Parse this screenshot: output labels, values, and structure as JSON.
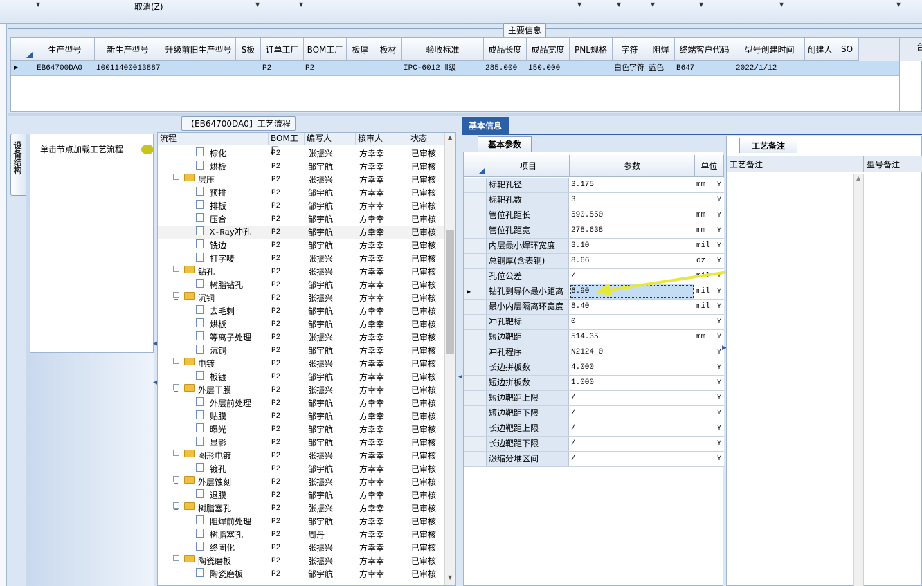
{
  "toolbar": {
    "cancel_label": "取消(Z)"
  },
  "main_info": {
    "title": "主要信息",
    "columns": [
      "生产型号",
      "新生产型号",
      "升级前旧生产型号",
      "S板",
      "订单工厂",
      "BOM工厂",
      "板厚",
      "板材",
      "验收标准",
      "成品长度",
      "成品宽度",
      "PNL规格",
      "字符",
      "阻焊",
      "终端客户代码",
      "型号创建时间",
      "创建人",
      "SO"
    ],
    "row": [
      "EB64700DA0",
      "10011400013887",
      "",
      "",
      "P2",
      "P2",
      "",
      "",
      "IPC-6012 Ⅱ级",
      "285.000",
      "150.000",
      "",
      "白色字符",
      "蓝色",
      "B647",
      "2022/1/12",
      "",
      ""
    ],
    "right_edge_text": "台"
  },
  "side_tab": {
    "label": "设备结构"
  },
  "tree_hint": {
    "label": "单击节点加载工艺流程"
  },
  "flow": {
    "title": "【EB64700DA0】工艺流程",
    "columns": [
      "流程",
      "BOM工厂",
      "编写人",
      "核审人",
      "状态"
    ],
    "rows": [
      {
        "name": "棕化",
        "level": 2,
        "bom": "P2",
        "author": "张振兴",
        "reviewer": "方幸幸",
        "status": "已审核"
      },
      {
        "name": "烘板",
        "level": 2,
        "bom": "P2",
        "author": "邹宇航",
        "reviewer": "方幸幸",
        "status": "已审核"
      },
      {
        "name": "层压",
        "level": 1,
        "bom": "P2",
        "author": "张振兴",
        "reviewer": "方幸幸",
        "status": "已审核"
      },
      {
        "name": "预排",
        "level": 2,
        "bom": "P2",
        "author": "邹宇航",
        "reviewer": "方幸幸",
        "status": "已审核"
      },
      {
        "name": "排板",
        "level": 2,
        "bom": "P2",
        "author": "邹宇航",
        "reviewer": "方幸幸",
        "status": "已审核"
      },
      {
        "name": "压合",
        "level": 2,
        "bom": "P2",
        "author": "邹宇航",
        "reviewer": "方幸幸",
        "status": "已审核"
      },
      {
        "name": "X-Ray冲孔",
        "level": 2,
        "bom": "P2",
        "author": "邹宇航",
        "reviewer": "方幸幸",
        "status": "已审核"
      },
      {
        "name": "铣边",
        "level": 2,
        "bom": "P2",
        "author": "邹宇航",
        "reviewer": "方幸幸",
        "status": "已审核"
      },
      {
        "name": "打字唛",
        "level": 2,
        "bom": "P2",
        "author": "张振兴",
        "reviewer": "方幸幸",
        "status": "已审核"
      },
      {
        "name": "钻孔",
        "level": 1,
        "bom": "P2",
        "author": "张振兴",
        "reviewer": "方幸幸",
        "status": "已审核"
      },
      {
        "name": "树脂钻孔",
        "level": 2,
        "bom": "P2",
        "author": "邹宇航",
        "reviewer": "方幸幸",
        "status": "已审核"
      },
      {
        "name": "沉铜",
        "level": 1,
        "bom": "P2",
        "author": "张振兴",
        "reviewer": "方幸幸",
        "status": "已审核"
      },
      {
        "name": "去毛刺",
        "level": 2,
        "bom": "P2",
        "author": "邹宇航",
        "reviewer": "方幸幸",
        "status": "已审核"
      },
      {
        "name": "烘板",
        "level": 2,
        "bom": "P2",
        "author": "邹宇航",
        "reviewer": "方幸幸",
        "status": "已审核"
      },
      {
        "name": "等离子处理",
        "level": 2,
        "bom": "P2",
        "author": "张振兴",
        "reviewer": "方幸幸",
        "status": "已审核"
      },
      {
        "name": "沉铜",
        "level": 2,
        "bom": "P2",
        "author": "邹宇航",
        "reviewer": "方幸幸",
        "status": "已审核"
      },
      {
        "name": "电镀",
        "level": 1,
        "bom": "P2",
        "author": "张振兴",
        "reviewer": "方幸幸",
        "status": "已审核"
      },
      {
        "name": "板镀",
        "level": 2,
        "bom": "P2",
        "author": "邹宇航",
        "reviewer": "方幸幸",
        "status": "已审核"
      },
      {
        "name": "外层干膜",
        "level": 1,
        "bom": "P2",
        "author": "张振兴",
        "reviewer": "方幸幸",
        "status": "已审核"
      },
      {
        "name": "外层前处理",
        "level": 2,
        "bom": "P2",
        "author": "邹宇航",
        "reviewer": "方幸幸",
        "status": "已审核"
      },
      {
        "name": "贴膜",
        "level": 2,
        "bom": "P2",
        "author": "邹宇航",
        "reviewer": "方幸幸",
        "status": "已审核"
      },
      {
        "name": "曝光",
        "level": 2,
        "bom": "P2",
        "author": "邹宇航",
        "reviewer": "方幸幸",
        "status": "已审核"
      },
      {
        "name": "显影",
        "level": 2,
        "bom": "P2",
        "author": "邹宇航",
        "reviewer": "方幸幸",
        "status": "已审核"
      },
      {
        "name": "图形电镀",
        "level": 1,
        "bom": "P2",
        "author": "张振兴",
        "reviewer": "方幸幸",
        "status": "已审核"
      },
      {
        "name": "镀孔",
        "level": 2,
        "bom": "P2",
        "author": "邹宇航",
        "reviewer": "方幸幸",
        "status": "已审核"
      },
      {
        "name": "外层蚀刻",
        "level": 1,
        "bom": "P2",
        "author": "张振兴",
        "reviewer": "方幸幸",
        "status": "已审核"
      },
      {
        "name": "退膜",
        "level": 2,
        "bom": "P2",
        "author": "邹宇航",
        "reviewer": "方幸幸",
        "status": "已审核"
      },
      {
        "name": "树脂塞孔",
        "level": 1,
        "bom": "P2",
        "author": "张振兴",
        "reviewer": "方幸幸",
        "status": "已审核"
      },
      {
        "name": "阻焊前处理",
        "level": 2,
        "bom": "P2",
        "author": "邹宇航",
        "reviewer": "方幸幸",
        "status": "已审核"
      },
      {
        "name": "树脂塞孔",
        "level": 2,
        "bom": "P2",
        "author": "周丹",
        "reviewer": "方幸幸",
        "status": "已审核"
      },
      {
        "name": "终固化",
        "level": 2,
        "bom": "P2",
        "author": "张振兴",
        "reviewer": "方幸幸",
        "status": "已审核"
      },
      {
        "name": "陶瓷磨板",
        "level": 1,
        "bom": "P2",
        "author": "张振兴",
        "reviewer": "方幸幸",
        "status": "已审核"
      },
      {
        "name": "陶瓷磨板",
        "level": 2,
        "bom": "P2",
        "author": "邹宇航",
        "reviewer": "方幸幸",
        "status": "已审核"
      }
    ]
  },
  "basic_info": {
    "tab_label": "基本信息",
    "subtab_label": "基本参数",
    "columns": [
      "项目",
      "参数",
      "单位"
    ],
    "rows": [
      {
        "item": "标靶孔径",
        "value": "3.175",
        "unit": "mm",
        "flag": "Y"
      },
      {
        "item": "标靶孔数",
        "value": "3",
        "unit": "",
        "flag": "Y"
      },
      {
        "item": "管位孔距长",
        "value": "590.550",
        "unit": "mm",
        "flag": "Y"
      },
      {
        "item": "管位孔距宽",
        "value": "278.638",
        "unit": "mm",
        "flag": "Y"
      },
      {
        "item": "内层最小焊环宽度",
        "value": "3.10",
        "unit": "mil",
        "flag": "Y"
      },
      {
        "item": "总铜厚(含表铜)",
        "value": "8.66",
        "unit": "oz",
        "flag": "Y"
      },
      {
        "item": "孔位公差",
        "value": "/",
        "unit": "mil",
        "flag": "Y"
      },
      {
        "item": "钻孔到导体最小距离",
        "value": "6.90",
        "unit": "mil",
        "flag": "Y"
      },
      {
        "item": "最小内层隔离环宽度",
        "value": "8.40",
        "unit": "mil",
        "flag": "Y"
      },
      {
        "item": "冲孔靶标",
        "value": "0",
        "unit": "",
        "flag": "Y"
      },
      {
        "item": "短边靶距",
        "value": "514.35",
        "unit": "mm",
        "flag": "Y"
      },
      {
        "item": "冲孔程序",
        "value": "N2124_0",
        "unit": "",
        "flag": "Y"
      },
      {
        "item": "长边拼板数",
        "value": "4.000",
        "unit": "",
        "flag": "Y"
      },
      {
        "item": "短边拼板数",
        "value": "1.000",
        "unit": "",
        "flag": "Y"
      },
      {
        "item": "短边靶距上限",
        "value": "/",
        "unit": "",
        "flag": "Y"
      },
      {
        "item": "短边靶距下限",
        "value": "/",
        "unit": "",
        "flag": "Y"
      },
      {
        "item": "长边靶距上限",
        "value": "/",
        "unit": "",
        "flag": "Y"
      },
      {
        "item": "长边靶距下限",
        "value": "/",
        "unit": "",
        "flag": "Y"
      },
      {
        "item": "涨缩分堆区间",
        "value": "/",
        "unit": "",
        "flag": "Y"
      }
    ],
    "selected_row": 7
  },
  "process_notes": {
    "tab_label": "工艺备注",
    "columns": [
      "工艺备注",
      "型号备注"
    ]
  },
  "colors": {
    "accent": "#2b5fa8",
    "selection": "#c5dcf5",
    "annotation_arrow": "#e8e83a"
  }
}
